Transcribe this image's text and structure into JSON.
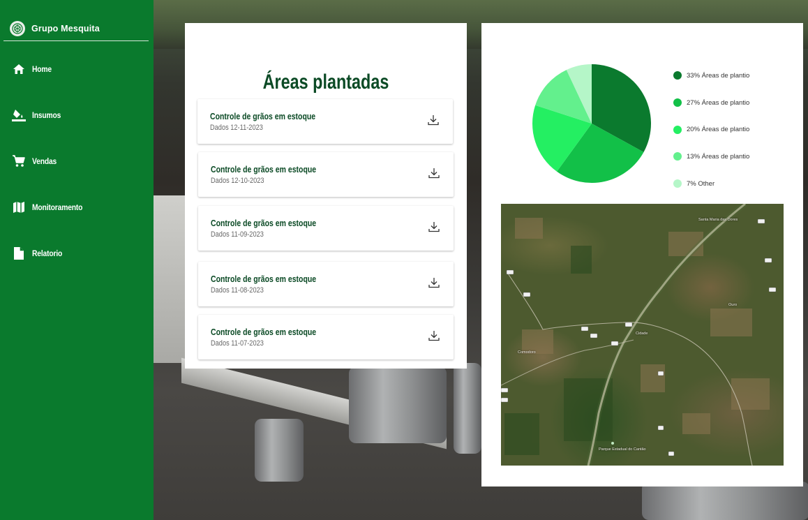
{
  "sidebar": {
    "brand": "Grupo Mesquita",
    "items": [
      {
        "label": "Home",
        "icon": "home-icon"
      },
      {
        "label": "Insumos",
        "icon": "paint-bucket-icon"
      },
      {
        "label": "Vendas",
        "icon": "cart-icon"
      },
      {
        "label": "Monitoramento",
        "icon": "map-icon"
      },
      {
        "label": "Relatorio",
        "icon": "document-icon"
      }
    ]
  },
  "reports": {
    "title": "Áreas plantadas",
    "items": [
      {
        "title": "Controle de grãos em estoque",
        "date": "Dados 12-11-2023"
      },
      {
        "title": "Controle de grãos em estoque",
        "date": "Dados 12-10-2023"
      },
      {
        "title": "Controle de grãos em estoque",
        "date": "Dados 11-09-2023"
      },
      {
        "title": "Controle de grãos em estoque",
        "date": "Dados 11-08-2023"
      },
      {
        "title": "Controle de grãos em estoque",
        "date": "Dados 11-07-2023"
      }
    ]
  },
  "chart_data": {
    "type": "pie",
    "title": "",
    "slices": [
      {
        "label": "33% Áreas de plantio",
        "value": 33,
        "color": "#0b7a2e"
      },
      {
        "label": "27% Áreas de plantio",
        "value": 27,
        "color": "#12c048"
      },
      {
        "label": "20% Áreas de plantio",
        "value": 20,
        "color": "#24ef62"
      },
      {
        "label": "13% Áreas de plantio",
        "value": 13,
        "color": "#63f08d"
      },
      {
        "label": "7% Other",
        "value": 7,
        "color": "#b5f6c8"
      }
    ],
    "legend_position": "right"
  },
  "map": {
    "labels": [
      "Santa Maria das Dores",
      "Ouro",
      "Cidade",
      "Comodoro",
      "Parque Estadual do Cantão"
    ]
  },
  "colors": {
    "sidebar": "#0a7a2d",
    "title_green": "#0b4a25"
  }
}
